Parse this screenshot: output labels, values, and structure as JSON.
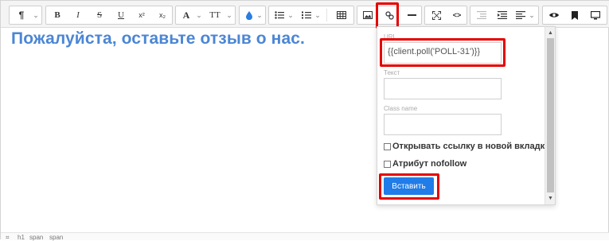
{
  "toolbar": {
    "paragraph_icon": "¶",
    "bold": "B",
    "italic": "I",
    "strike": "S",
    "underline": "U",
    "superscript": "x²",
    "subscript": "x₂",
    "font_name": "A",
    "font_size": "TT",
    "color_icon": "drop-icon",
    "ul_icon": "unordered-list-icon",
    "ol_icon": "ordered-list-icon",
    "table_icon": "table-icon",
    "image_icon": "image-icon",
    "link_icon": "link-icon",
    "hr_icon": "horizontal-rule-icon",
    "fullscreen_icon": "fullscreen-icon",
    "code_icon": "<>",
    "outdent_icon": "outdent-icon",
    "indent_icon": "indent-icon",
    "align_icon": "align-left-icon",
    "preview_icon": "eye-icon",
    "bookmark_icon": "bookmark-icon",
    "monitor_icon": "monitor-icon"
  },
  "content": {
    "title": "Пожалуйста, оставьте отзыв о нас."
  },
  "popup": {
    "url_label": "URL",
    "url_value": "{{client.poll('POLL-31')}}",
    "text_label": "Текст",
    "text_value": "",
    "class_label": "Class name",
    "class_value": "",
    "new_tab_label": "Открывать ссылку в новой вкладке",
    "nofollow_label": "Атрибут nofollow",
    "insert_label": "Вставить"
  },
  "statusbar": {
    "path": [
      "h1",
      "span",
      "span"
    ]
  },
  "colors": {
    "accent": "#1f7ce8",
    "title": "#4b86d4",
    "highlight": "#e60000"
  }
}
